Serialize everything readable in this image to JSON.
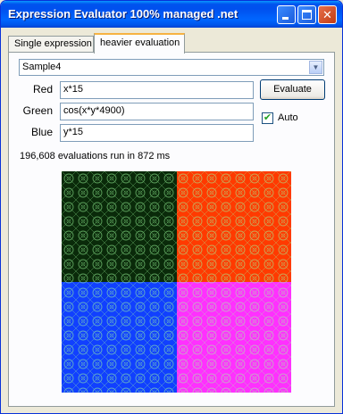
{
  "window": {
    "title": "Expression Evaluator 100% managed .net"
  },
  "tabs": [
    {
      "label": "Single expression",
      "active": false
    },
    {
      "label": "heavier evaluation",
      "active": true
    }
  ],
  "sample_select": {
    "value": "Sample4"
  },
  "fields": {
    "red_label": "Red",
    "red_value": "x*15",
    "green_label": "Green",
    "green_value": "cos(x*y*4900)",
    "blue_label": "Blue",
    "blue_value": "y*15"
  },
  "evaluate_button": "Evaluate",
  "auto_checkbox": {
    "label": "Auto",
    "checked": true
  },
  "status": "196,608 evaluations run in 872 ms",
  "image_colors": {
    "top_left": "#0a2a0a",
    "top_right": "#ff3a00",
    "bottom_left": "#1140ff",
    "bottom_right": "#ff30ff",
    "pattern": "#9dff9d"
  }
}
